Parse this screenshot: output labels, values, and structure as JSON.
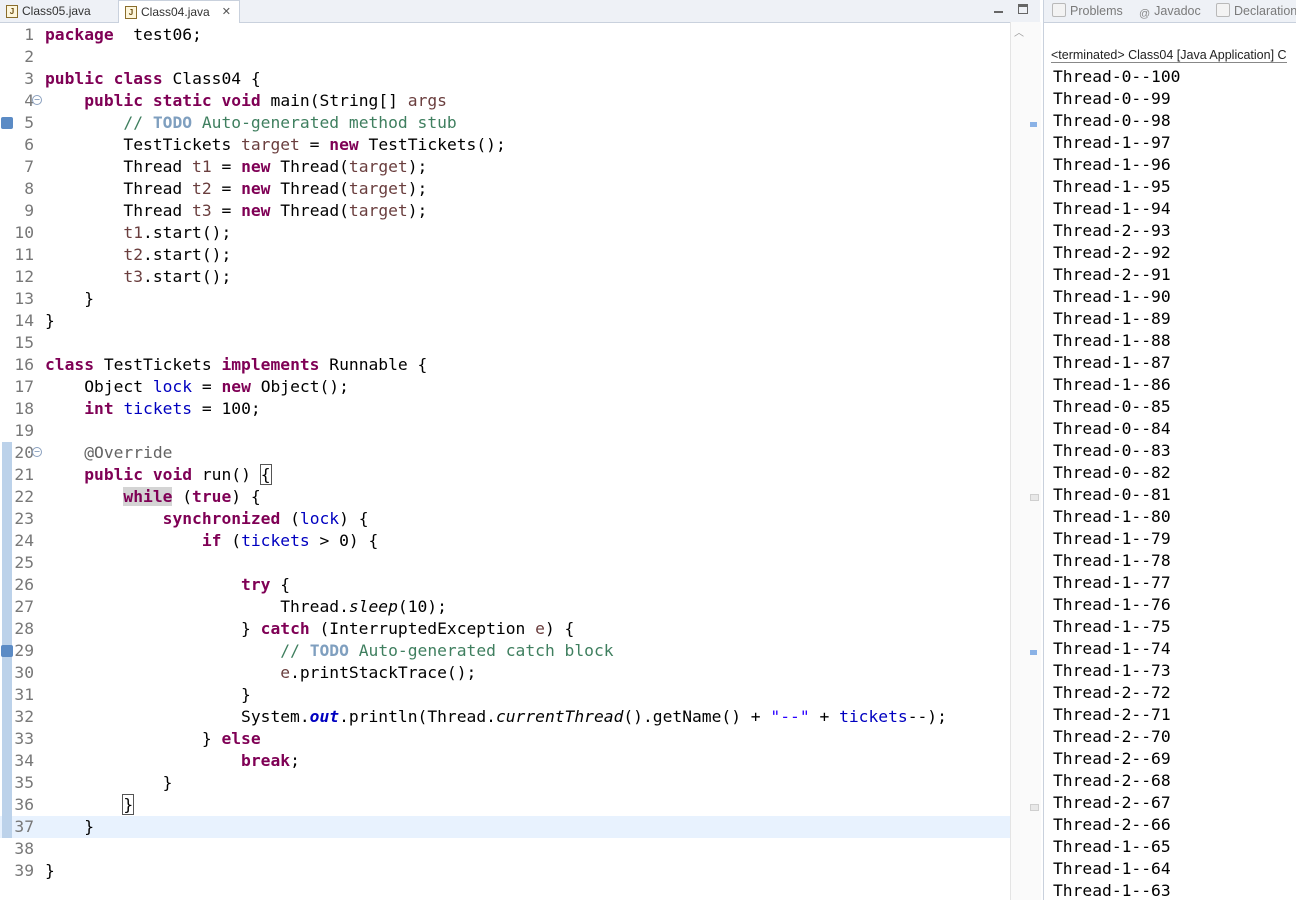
{
  "editor": {
    "tabs": [
      {
        "label": "Class05.java",
        "active": false
      },
      {
        "label": "Class04.java",
        "active": true,
        "close": "✕"
      }
    ],
    "current_line": 37,
    "lines": [
      {
        "n": "1",
        "segs": [
          [
            "kw",
            "package"
          ],
          [
            "",
            "  test06;"
          ]
        ]
      },
      {
        "n": "2",
        "segs": []
      },
      {
        "n": "3",
        "segs": [
          [
            "kw",
            "public"
          ],
          [
            "",
            " "
          ],
          [
            "kw",
            "class"
          ],
          [
            "",
            " Class04 {"
          ]
        ]
      },
      {
        "n": "4",
        "fold": true,
        "segs": [
          [
            "",
            "    "
          ],
          [
            "kw",
            "public"
          ],
          [
            "",
            " "
          ],
          [
            "kw",
            "static"
          ],
          [
            "",
            " "
          ],
          [
            "kw",
            "void"
          ],
          [
            "",
            " main(String[] "
          ],
          [
            "var",
            "args"
          ],
          [
            ") {"
          ]
        ]
      },
      {
        "n": "5",
        "task": true,
        "segs": [
          [
            "",
            "        "
          ],
          [
            "cmt",
            "// "
          ],
          [
            "todo",
            "TODO"
          ],
          [
            "cmt",
            " Auto-generated method stub"
          ]
        ]
      },
      {
        "n": "6",
        "segs": [
          [
            "",
            "        TestTickets "
          ],
          [
            "var",
            "target"
          ],
          [
            "",
            " = "
          ],
          [
            "kw",
            "new"
          ],
          [
            "",
            " TestTickets();"
          ]
        ]
      },
      {
        "n": "7",
        "segs": [
          [
            "",
            "        Thread "
          ],
          [
            "var",
            "t1"
          ],
          [
            "",
            " = "
          ],
          [
            "kw",
            "new"
          ],
          [
            "",
            " Thread("
          ],
          [
            "var",
            "target"
          ],
          [
            "",
            "); "
          ]
        ]
      },
      {
        "n": "8",
        "segs": [
          [
            "",
            "        Thread "
          ],
          [
            "var",
            "t2"
          ],
          [
            "",
            " = "
          ],
          [
            "kw",
            "new"
          ],
          [
            "",
            " Thread("
          ],
          [
            "var",
            "target"
          ],
          [
            "",
            "); "
          ]
        ]
      },
      {
        "n": "9",
        "segs": [
          [
            "",
            "        Thread "
          ],
          [
            "var",
            "t3"
          ],
          [
            "",
            " = "
          ],
          [
            "kw",
            "new"
          ],
          [
            "",
            " Thread("
          ],
          [
            "var",
            "target"
          ],
          [
            "",
            "); "
          ]
        ]
      },
      {
        "n": "10",
        "segs": [
          [
            "",
            "        "
          ],
          [
            "var",
            "t1"
          ],
          [
            "",
            ".start();"
          ]
        ]
      },
      {
        "n": "11",
        "segs": [
          [
            "",
            "        "
          ],
          [
            "var",
            "t2"
          ],
          [
            "",
            ".start();"
          ]
        ]
      },
      {
        "n": "12",
        "segs": [
          [
            "",
            "        "
          ],
          [
            "var",
            "t3"
          ],
          [
            "",
            ".start();"
          ]
        ]
      },
      {
        "n": "13",
        "segs": [
          [
            "",
            "    }"
          ]
        ]
      },
      {
        "n": "14",
        "segs": [
          [
            "",
            "}"
          ]
        ]
      },
      {
        "n": "15",
        "segs": []
      },
      {
        "n": "16",
        "segs": [
          [
            "kw",
            "class"
          ],
          [
            "",
            " TestTickets "
          ],
          [
            "kw",
            "implements"
          ],
          [
            "",
            " Runnable {"
          ]
        ]
      },
      {
        "n": "17",
        "segs": [
          [
            "",
            "    Object "
          ],
          [
            "fld",
            "lock"
          ],
          [
            "",
            " = "
          ],
          [
            "kw",
            "new"
          ],
          [
            "",
            " Object();"
          ]
        ]
      },
      {
        "n": "18",
        "segs": [
          [
            "",
            "    "
          ],
          [
            "kw",
            "int"
          ],
          [
            "",
            " "
          ],
          [
            "fld",
            "tickets"
          ],
          [
            "",
            " = 100;"
          ]
        ]
      },
      {
        "n": "19",
        "segs": []
      },
      {
        "n": "20",
        "fold": true,
        "bar": true,
        "segs": [
          [
            "",
            "    "
          ],
          [
            "ann",
            "@Override"
          ]
        ]
      },
      {
        "n": "21",
        "bar": true,
        "segs": [
          [
            "",
            "    "
          ],
          [
            "kw",
            "public"
          ],
          [
            "",
            " "
          ],
          [
            "kw",
            "void"
          ],
          [
            "",
            " run() "
          ],
          [
            "box",
            "{"
          ]
        ]
      },
      {
        "n": "22",
        "bar": true,
        "segs": [
          [
            "",
            "        "
          ],
          [
            "kwhl",
            "while"
          ],
          [
            "",
            " ("
          ],
          [
            "kw",
            "true"
          ],
          [
            "",
            ") {"
          ]
        ]
      },
      {
        "n": "23",
        "bar": true,
        "segs": [
          [
            "",
            "            "
          ],
          [
            "kw",
            "synchronized"
          ],
          [
            "",
            " ("
          ],
          [
            "fld",
            "lock"
          ],
          [
            "",
            ") {"
          ]
        ]
      },
      {
        "n": "24",
        "bar": true,
        "segs": [
          [
            "",
            "                "
          ],
          [
            "kw",
            "if"
          ],
          [
            "",
            " ("
          ],
          [
            "fld",
            "tickets"
          ],
          [
            "",
            " > 0) {"
          ]
        ]
      },
      {
        "n": "25",
        "bar": true,
        "segs": []
      },
      {
        "n": "26",
        "bar": true,
        "segs": [
          [
            "",
            "                    "
          ],
          [
            "kw",
            "try"
          ],
          [
            "",
            " {"
          ]
        ]
      },
      {
        "n": "27",
        "bar": true,
        "segs": [
          [
            "",
            "                        Thread."
          ],
          [
            "smeth",
            "sleep"
          ],
          [
            "",
            "(10);"
          ]
        ]
      },
      {
        "n": "28",
        "bar": true,
        "segs": [
          [
            "",
            "                    } "
          ],
          [
            "kw",
            "catch"
          ],
          [
            "",
            " (InterruptedException "
          ],
          [
            "var",
            "e"
          ],
          [
            "",
            ") {"
          ]
        ]
      },
      {
        "n": "29",
        "bar": true,
        "task": true,
        "segs": [
          [
            "",
            "                        "
          ],
          [
            "cmt",
            "// "
          ],
          [
            "todo",
            "TODO"
          ],
          [
            "cmt",
            " Auto-generated catch block"
          ]
        ]
      },
      {
        "n": "30",
        "bar": true,
        "segs": [
          [
            "",
            "                        "
          ],
          [
            "var",
            "e"
          ],
          [
            "",
            ".printStackTrace();"
          ]
        ]
      },
      {
        "n": "31",
        "bar": true,
        "segs": [
          [
            "",
            "                    }"
          ]
        ]
      },
      {
        "n": "32",
        "bar": true,
        "segs": [
          [
            "",
            "                    System."
          ],
          [
            "sfld",
            "out"
          ],
          [
            "",
            ".println(Thread."
          ],
          [
            "smeth",
            "currentThread"
          ],
          [
            "",
            "().getName() + "
          ],
          [
            "str",
            "\"--\""
          ],
          [
            "",
            " + "
          ],
          [
            "fld",
            "tickets"
          ],
          [
            "",
            "--);"
          ]
        ]
      },
      {
        "n": "33",
        "bar": true,
        "segs": [
          [
            "",
            "                } "
          ],
          [
            "kw",
            "else"
          ]
        ]
      },
      {
        "n": "34",
        "bar": true,
        "segs": [
          [
            "",
            "                    "
          ],
          [
            "kw",
            "break"
          ],
          [
            "",
            ";"
          ]
        ]
      },
      {
        "n": "35",
        "bar": true,
        "segs": [
          [
            "",
            "            }"
          ]
        ]
      },
      {
        "n": "36",
        "bar": true,
        "segs": [
          [
            "",
            "        "
          ],
          [
            "box",
            "}"
          ]
        ]
      },
      {
        "n": "37",
        "bar": true,
        "segs": [
          [
            "",
            "    }"
          ]
        ]
      },
      {
        "n": "38",
        "segs": []
      },
      {
        "n": "39",
        "segs": [
          [
            "",
            "}"
          ]
        ]
      }
    ]
  },
  "console": {
    "tabs": [
      {
        "label": "Problems",
        "icon": "problems-icon"
      },
      {
        "label": "Javadoc",
        "icon": "javadoc-icon"
      },
      {
        "label": "Declaration",
        "icon": "declaration-icon"
      }
    ],
    "header": "<terminated> Class04 [Java Application] C",
    "output": [
      "Thread-0--100",
      "Thread-0--99",
      "Thread-0--98",
      "Thread-1--97",
      "Thread-1--96",
      "Thread-1--95",
      "Thread-1--94",
      "Thread-2--93",
      "Thread-2--92",
      "Thread-2--91",
      "Thread-1--90",
      "Thread-1--89",
      "Thread-1--88",
      "Thread-1--87",
      "Thread-1--86",
      "Thread-0--85",
      "Thread-0--84",
      "Thread-0--83",
      "Thread-0--82",
      "Thread-0--81",
      "Thread-1--80",
      "Thread-1--79",
      "Thread-1--78",
      "Thread-1--77",
      "Thread-1--76",
      "Thread-1--75",
      "Thread-1--74",
      "Thread-1--73",
      "Thread-2--72",
      "Thread-2--71",
      "Thread-2--70",
      "Thread-2--69",
      "Thread-2--68",
      "Thread-2--67",
      "Thread-2--66",
      "Thread-1--65",
      "Thread-1--64",
      "Thread-1--63"
    ]
  }
}
